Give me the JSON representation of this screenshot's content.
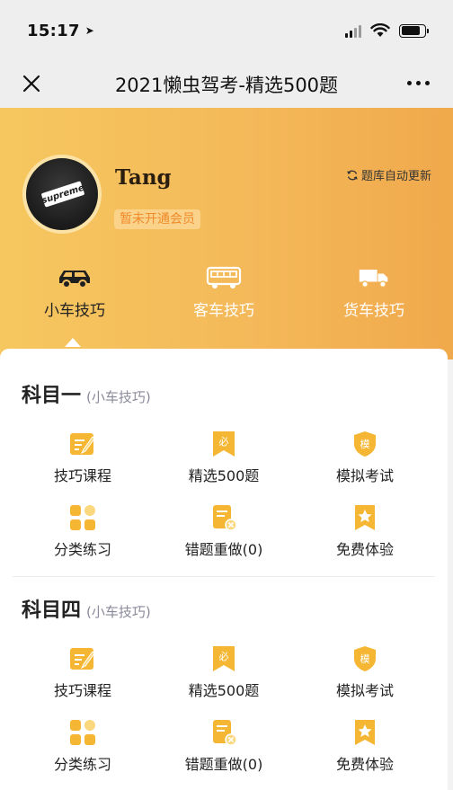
{
  "status_bar": {
    "time": "15:17"
  },
  "nav": {
    "title": "2021懒虫驾考-精选500题"
  },
  "profile": {
    "username": "Tang",
    "membership_badge": "暂未开通会员",
    "auto_update": "题库自动更新",
    "avatar_text": "supreme"
  },
  "vehicle_tabs": [
    {
      "label": "小车技巧",
      "icon": "car-icon",
      "active": true
    },
    {
      "label": "客车技巧",
      "icon": "bus-icon",
      "active": false
    },
    {
      "label": "货车技巧",
      "icon": "truck-icon",
      "active": false
    }
  ],
  "sections": [
    {
      "title": "科目一",
      "subtitle": "(小车技巧)",
      "items": [
        {
          "label": "技巧课程",
          "icon": "course-icon"
        },
        {
          "label": "精选500题",
          "icon": "must-bookmark-icon"
        },
        {
          "label": "模拟考试",
          "icon": "mock-shield-icon"
        },
        {
          "label": "分类练习",
          "icon": "category-grid-icon"
        },
        {
          "label": "错题重做(0)",
          "icon": "wrong-doc-icon"
        },
        {
          "label": "免费体验",
          "icon": "star-bookmark-icon"
        }
      ]
    },
    {
      "title": "科目四",
      "subtitle": "(小车技巧)",
      "items": [
        {
          "label": "技巧课程",
          "icon": "course-icon"
        },
        {
          "label": "精选500题",
          "icon": "must-bookmark-icon"
        },
        {
          "label": "模拟考试",
          "icon": "mock-shield-icon"
        },
        {
          "label": "分类练习",
          "icon": "category-grid-icon"
        },
        {
          "label": "错题重做(0)",
          "icon": "wrong-doc-icon"
        },
        {
          "label": "免费体验",
          "icon": "star-bookmark-icon"
        }
      ]
    }
  ],
  "colors": {
    "accent": "#f4b95a",
    "icon_yellow": "#f5b733",
    "icon_light": "#fbd77e"
  }
}
